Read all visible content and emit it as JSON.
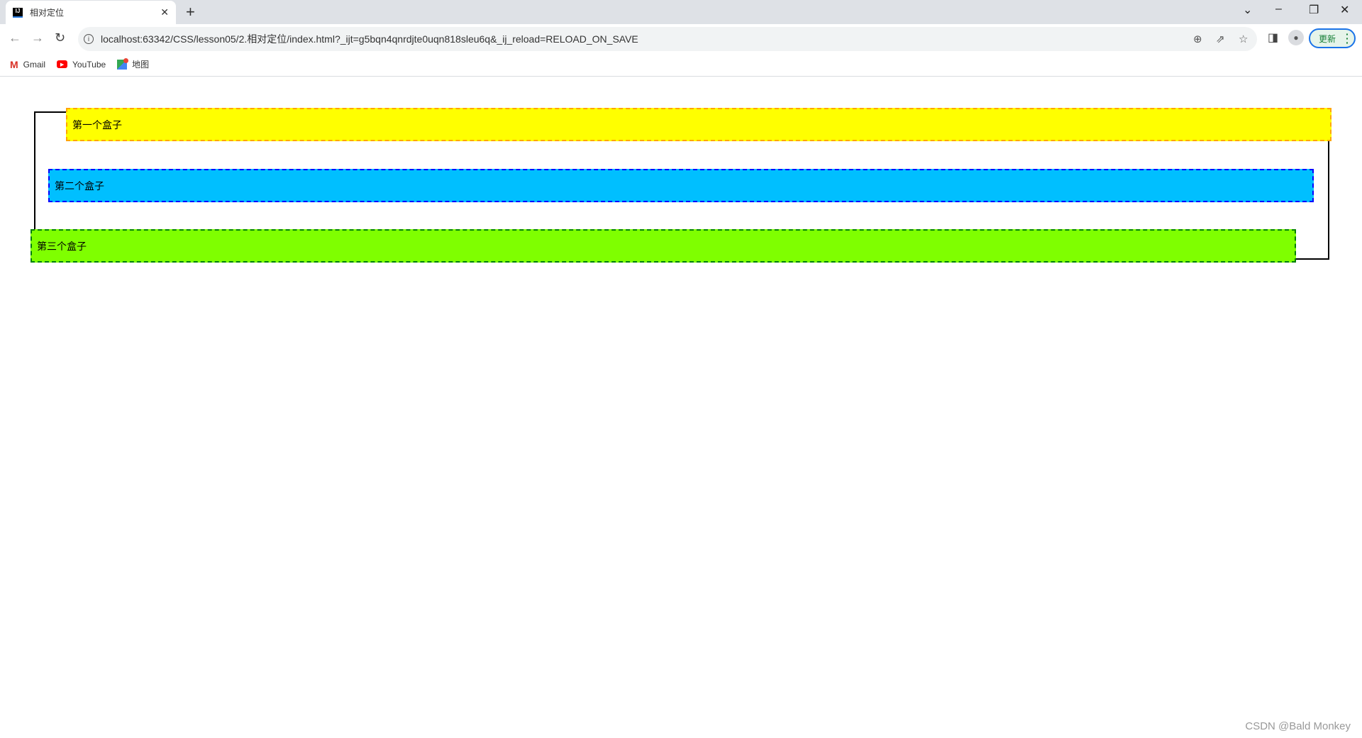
{
  "browser": {
    "tab": {
      "title": "相对定位",
      "favicon": "IJ",
      "close": "✕"
    },
    "new_tab": "+",
    "window": {
      "tab_search": "⌄",
      "minimize": "–",
      "restore": "❐",
      "close": "✕"
    },
    "nav": {
      "back": "←",
      "forward": "→",
      "reload": "↻"
    },
    "url": "localhost:63342/CSS/lesson05/2.相对定位/index.html?_ijt=g5bqn4qnrdjte0uqn818sleu6q&_ij_reload=RELOAD_ON_SAVE",
    "update_label": "更新",
    "bookmarks": [
      {
        "label": "Gmail",
        "icon": "gmail-icon"
      },
      {
        "label": "YouTube",
        "icon": "youtube-icon"
      },
      {
        "label": "地图",
        "icon": "maps-icon"
      }
    ]
  },
  "page": {
    "boxes": [
      {
        "label": "第一个盒子",
        "background": "#ffff00",
        "border": "#ffa500"
      },
      {
        "label": "第二个盒子",
        "background": "#00bfff",
        "border": "#0000ff"
      },
      {
        "label": "第三个盒子",
        "background": "#7fff00",
        "border": "#008000"
      }
    ]
  },
  "watermark": "CSDN @Bald Monkey"
}
